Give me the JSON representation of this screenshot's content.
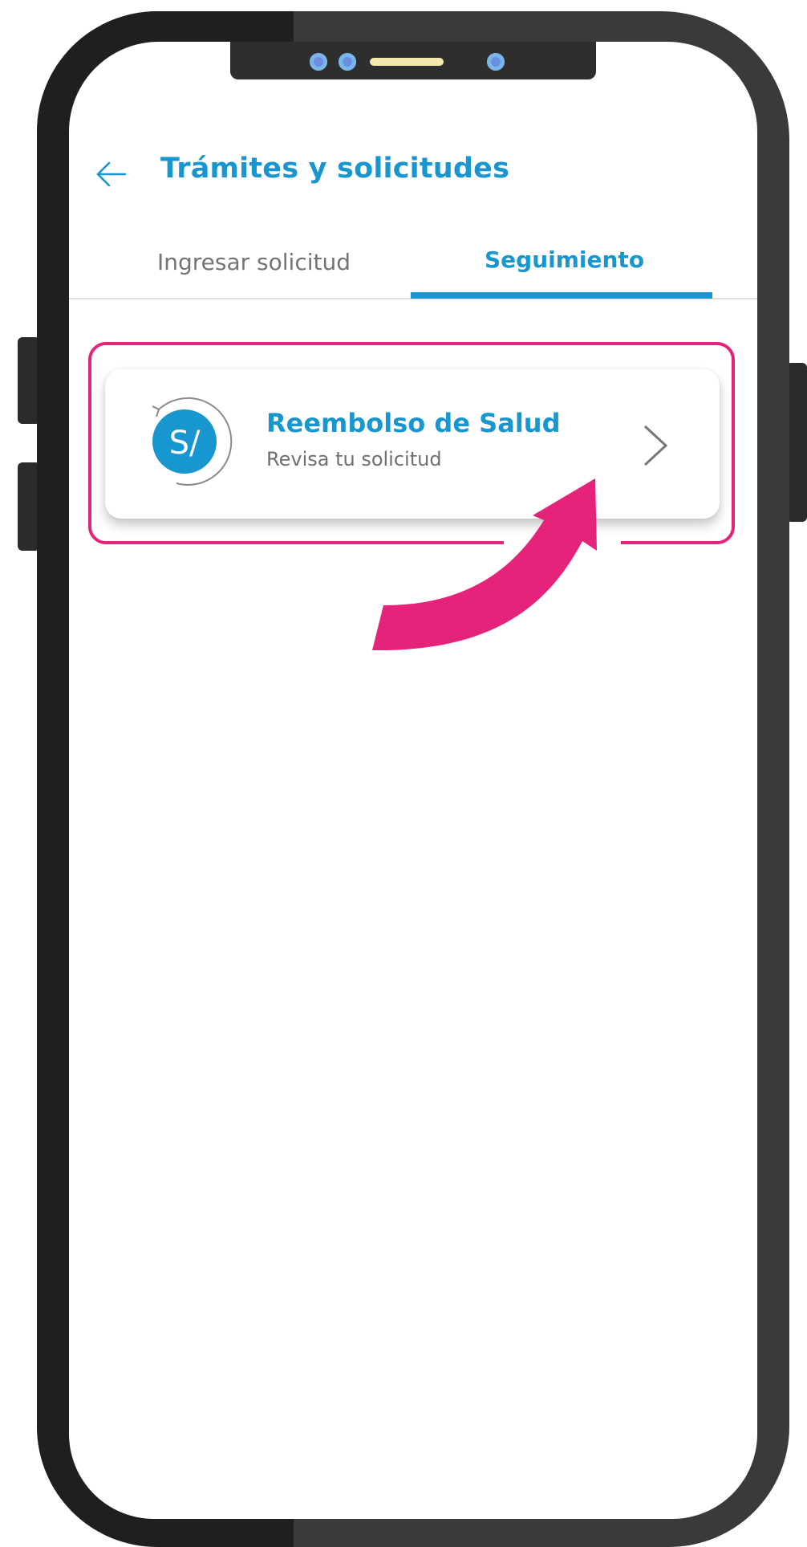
{
  "header": {
    "title": "Trámites y solicitudes",
    "back_icon": "arrow-left-icon"
  },
  "tabs": [
    {
      "label": "Ingresar solicitud",
      "active": false
    },
    {
      "label": "Seguimiento",
      "active": true
    }
  ],
  "card": {
    "icon": "currency-soles-refresh-icon",
    "icon_text": "S/",
    "title": "Reembolso de Salud",
    "subtitle": "Revisa tu solicitud",
    "chevron_icon": "chevron-right-icon"
  },
  "annotation": {
    "type": "highlight-with-arrow",
    "highlight_icon": "curved-arrow-icon"
  },
  "colors": {
    "accent": "#1796cf",
    "highlight": "#e5237a",
    "inactive_text": "#737373",
    "frame_dark": "#1f1f1f",
    "frame": "#3a3a3a"
  }
}
